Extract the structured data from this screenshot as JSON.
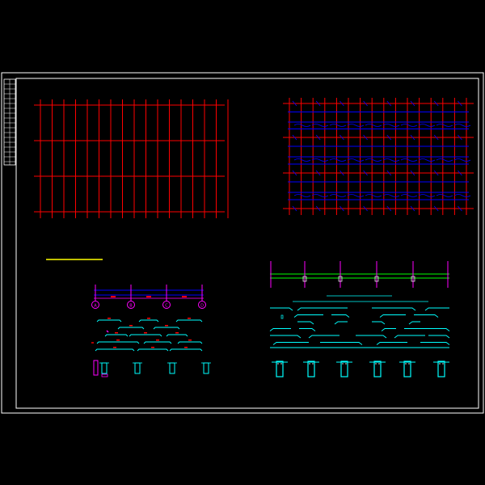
{
  "drawing": {
    "background": "#000000",
    "colors": {
      "frame": "#ffffff",
      "grid": "#ff0000",
      "beam": "#0000ff",
      "rebar": "#00ffff",
      "dim": "#ff00ff",
      "accent": "#00ff00",
      "yellow": "#ffff00"
    },
    "axis_labels": [
      "A",
      "B",
      "C",
      "D"
    ],
    "sheets": {
      "plan_grid": "structural-grid-plan",
      "beam_layout": "beam-reinforcement-plan",
      "section_left": "beam-elevation-left",
      "section_right": "beam-elevation-right"
    }
  }
}
